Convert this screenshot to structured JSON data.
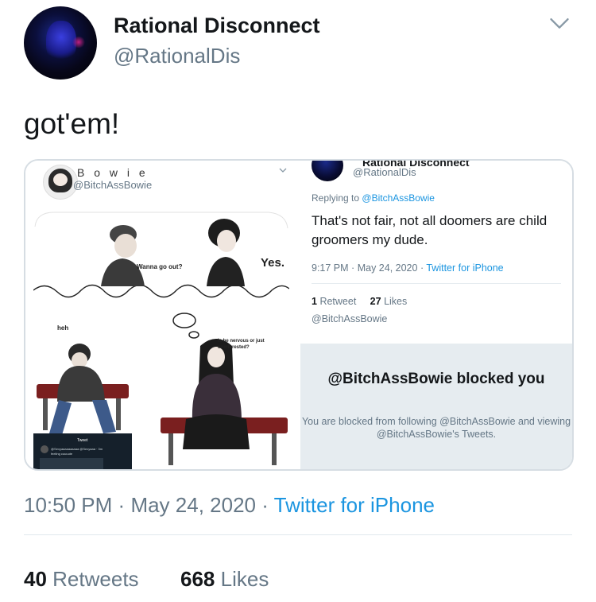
{
  "tweet": {
    "display_name": "Rational Disconnect",
    "handle": "@RationalDis",
    "text": "got'em!",
    "time": "10:50 PM",
    "date": "May 24, 2020",
    "source": "Twitter for iPhone",
    "retweets_count": "40",
    "retweets_label": "Retweets",
    "likes_count": "668",
    "likes_label": "Likes",
    "dot": "·"
  },
  "media": {
    "left": {
      "name": "B o w i e",
      "handle": "@BitchAssBowie",
      "meme_text": {
        "speech_1": "Wanna go out?",
        "speech_2": "Yes.",
        "heh": "heh",
        "thought": "Is he nervous or just uninterested?",
        "phone_title": "Tweet",
        "phone_line1": "@Sexyaaaaaaaaaa @Sexyaaa · 3m",
        "phone_line2": "feeling cuuuute"
      }
    },
    "right": {
      "name_cut": "Rational Disconnect",
      "handle": "@RationalDis",
      "replying_prefix": "Replying to",
      "replying_to": "@BitchAssBowie",
      "reply_text": "That's not fair, not all doomers are child groomers my dude.",
      "time": "9:17 PM",
      "date": "May 24, 2020",
      "source": "Twitter for iPhone",
      "retweet_count": "1",
      "retweet_label": "Retweet",
      "likes_count": "27",
      "likes_label": "Likes",
      "bowie_tag": "@BitchAssBowie",
      "blocked_title": "@BitchAssBowie blocked you",
      "blocked_desc": "You are blocked from following @BitchAssBowie and viewing @BitchAssBowie's Tweets."
    }
  },
  "icons": {
    "header_chevron": "chevron-down-icon",
    "card_chevron": "chevron-down-icon"
  },
  "colors": {
    "link": "#1b95e0",
    "secondary_text": "#657786",
    "primary_text": "#14171a",
    "blocked_bg": "#e6ecf0"
  }
}
